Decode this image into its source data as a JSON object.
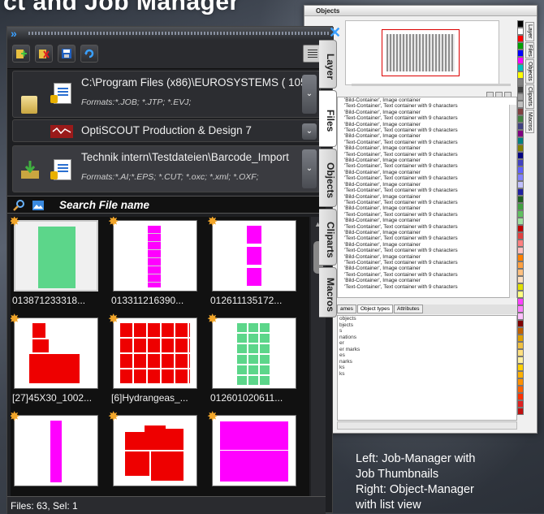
{
  "headline": "ct and Job Manager",
  "objects_window": {
    "title": "Objects",
    "side_tabs": [
      "Layer",
      "Files",
      "Objects",
      "Cliparts",
      "Macros"
    ],
    "list_rows": [
      "'Bild-Container', Image container",
      "'Text-Container', Text container with 9 characters",
      "'Bild-Container', Image container",
      "'Text-Container', Text container with 9 characters",
      "'Bild-Container', Image container",
      "'Text-Container', Text container with 9 characters",
      "'Bild-Container', Image container",
      "'Text-Container', Text container with 9 characters",
      "'Bild-Container', Image container",
      "'Text-Container', Text container with 9 characters",
      "'Bild-Container', Image container",
      "'Text-Container', Text container with 9 characters",
      "'Bild-Container', Image container",
      "'Text-Container', Text container with 9 characters",
      "'Bild-Container', Image container",
      "'Text-Container', Text container with 9 characters",
      "'Bild-Container', Image container",
      "'Text-Container', Text container with 9 characters",
      "'Bild-Container', Image container",
      "'Text-Container', Text container with 9 characters",
      "'Bild-Container', Image container",
      "'Text-Container', Text container with 9 characters",
      "'Bild-Container', Image container",
      "'Text-Container', Text container with 9 characters",
      "'Bild-Container', Image container",
      "'Text-Container', Text container with 9 characters",
      "'Bild-Container', Image container",
      "'Text-Container', Text container with 9 characters",
      "'Bild-Container', Image container",
      "'Text-Container', Text container with 9 characters",
      "'Bild-Container', Image container",
      "'Text-Container', Text container with 9 characters"
    ],
    "bottom_tabs": [
      "ames",
      "Object types",
      "Attributes"
    ],
    "type_rows": [
      "",
      "",
      "objects",
      "bjects",
      "s",
      "nations",
      "",
      "",
      "er",
      "er marks",
      "es",
      "narks",
      "ks",
      "ks"
    ],
    "palette": [
      "#000000",
      "#ffffff",
      "#ff0000",
      "#00a000",
      "#0000ff",
      "#ff00ff",
      "#00c0c0",
      "#ffff00",
      "#808080",
      "#404040",
      "#a0a0a0",
      "#c0c0c0",
      "#804040",
      "#408040",
      "#404080",
      "#800080",
      "#008080",
      "#808000",
      "#000080",
      "#4040c0",
      "#6060ff",
      "#8080ff",
      "#c0c0ff",
      "#2020a0",
      "#206020",
      "#40a040",
      "#60c060",
      "#a0e0a0",
      "#c00000",
      "#e04040",
      "#ff8080",
      "#ffc0c0",
      "#ff8000",
      "#ffa040",
      "#ffc080",
      "#ffe0c0",
      "#e0e000",
      "#ffff80",
      "#ff40ff",
      "#ff80ff",
      "#ffc0ff",
      "#800000",
      "#c06000",
      "#e0a000",
      "#f0c040",
      "#ffe080",
      "#fff0a0",
      "#ffd000",
      "#ffb000",
      "#ff9000",
      "#ff6000",
      "#ff3000",
      "#e02020",
      "#c01010"
    ]
  },
  "job_manager": {
    "folders": [
      {
        "path": "C:\\Program Files (x86)\\EUROSYSTEMS ( 105",
        "formats": "Formats:*.JOB; *.JTP; *.EVJ;"
      },
      {
        "path": "OptiSCOUT Production & Design 7",
        "formats": ""
      },
      {
        "path": "Technik intern\\Testdateien\\Barcode_Import",
        "formats": "Formats:*.AI;*.EPS; *.CUT; *.oxc; *.xml; *.OXF;"
      }
    ],
    "search_placeholder": "Search File name",
    "side_tabs": [
      "Layer",
      "Files",
      "Objects",
      "Cliparts",
      "Macros"
    ],
    "thumbnails": [
      {
        "label": "013871233318..."
      },
      {
        "label": "013311216390..."
      },
      {
        "label": "012611135172..."
      },
      {
        "label": "[27]45X30_1002..."
      },
      {
        "label": "[6]Hydrangeas_..."
      },
      {
        "label": "012601020611..."
      },
      {
        "label": ""
      },
      {
        "label": ""
      },
      {
        "label": ""
      }
    ],
    "status": "Files: 63, Sel: 1"
  },
  "caption": [
    "Left: Job-Manager with",
    "Job Thumbnails",
    "Right: Object-Manager",
    "with list view"
  ],
  "colors": {
    "accent_blue": "#3aa0ff",
    "magenta": "#ff00ff",
    "red": "#ff0000",
    "green": "#5cd68a",
    "star": "#f2a62a"
  }
}
